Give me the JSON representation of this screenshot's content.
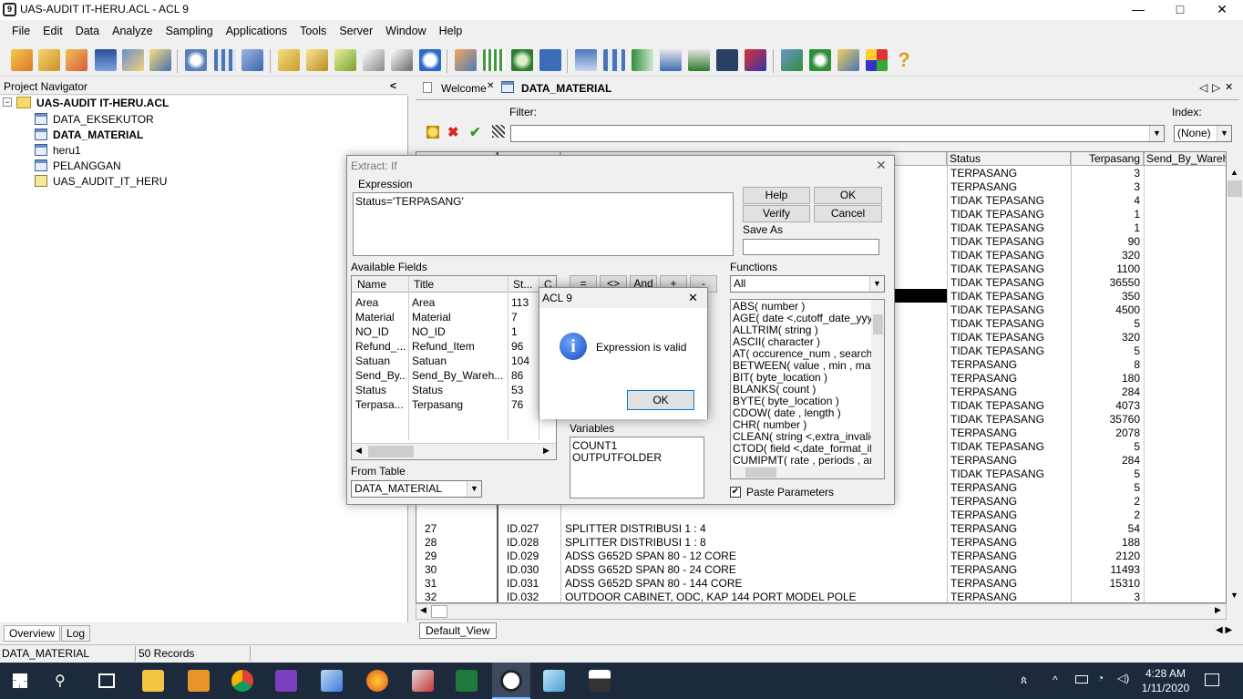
{
  "window": {
    "title": "UAS-AUDIT IT-HERU.ACL - ACL 9",
    "min": "—",
    "max": "□",
    "close": "✕",
    "icon_text": "9"
  },
  "menu": [
    "File",
    "Edit",
    "Data",
    "Analyze",
    "Sampling",
    "Applications",
    "Tools",
    "Server",
    "Window",
    "Help"
  ],
  "navigator": {
    "title": "Project Navigator",
    "collapse": "<",
    "project": "UAS-AUDIT IT-HERU.ACL",
    "expander": "−",
    "items": [
      {
        "label": "DATA_EKSEKUTOR",
        "bold": false
      },
      {
        "label": "DATA_MATERIAL",
        "bold": true
      },
      {
        "label": "heru1",
        "bold": false
      },
      {
        "label": "PELANGGAN",
        "bold": false
      },
      {
        "label": "UAS_AUDIT_IT_HERU",
        "bold": false
      }
    ],
    "tabs": [
      "Overview",
      "Log"
    ]
  },
  "tabs": {
    "welcome": "Welcome",
    "active": "DATA_MATERIAL",
    "nav_prev": "◁",
    "nav_next": "▷",
    "close": "✕"
  },
  "filter": {
    "label": "Filter:",
    "value": "",
    "index_label": "Index:",
    "index_value": "(None)"
  },
  "grid": {
    "headers": {
      "status": "Status",
      "terpasang": "Terpasang",
      "send": "Send_By_Wareh"
    },
    "upper_rows": [
      {
        "status": "TERPASANG",
        "terpasang": "3"
      },
      {
        "status": "TERPASANG",
        "terpasang": "3"
      },
      {
        "status": "TIDAK TEPASANG",
        "terpasang": "4"
      },
      {
        "status": "TIDAK TEPASANG",
        "terpasang": "1"
      },
      {
        "status": "TIDAK TEPASANG",
        "terpasang": "1"
      },
      {
        "status": "TIDAK TEPASANG",
        "terpasang": "90"
      },
      {
        "status": "TIDAK TEPASANG",
        "terpasang": "320"
      },
      {
        "status": "TIDAK TEPASANG",
        "terpasang": "1100"
      },
      {
        "status": "TIDAK TEPASANG",
        "terpasang": "36550"
      },
      {
        "status": "TIDAK TEPASANG",
        "terpasang": "350"
      },
      {
        "status": "TIDAK TEPASANG",
        "terpasang": "4500"
      },
      {
        "status": "TIDAK TEPASANG",
        "terpasang": "5"
      },
      {
        "status": "TIDAK TEPASANG",
        "terpasang": "320"
      },
      {
        "status": "TIDAK TEPASANG",
        "terpasang": "5"
      },
      {
        "status": "TERPASANG",
        "terpasang": "8"
      },
      {
        "status": "TERPASANG",
        "terpasang": "180"
      },
      {
        "status": "TERPASANG",
        "terpasang": "284"
      },
      {
        "status": "TIDAK TEPASANG",
        "terpasang": "4073"
      },
      {
        "status": "TIDAK TEPASANG",
        "terpasang": "35760"
      },
      {
        "status": "TERPASANG",
        "terpasang": "2078"
      },
      {
        "status": "TIDAK TEPASANG",
        "terpasang": "5"
      },
      {
        "status": "TERPASANG",
        "terpasang": "284"
      },
      {
        "status": "TIDAK TEPASANG",
        "terpasang": "5"
      },
      {
        "status": "TERPASANG",
        "terpasang": "5"
      },
      {
        "status": "TERPASANG",
        "terpasang": "2"
      },
      {
        "status": "TERPASANG",
        "terpasang": "2"
      }
    ],
    "lower_rows": [
      {
        "num": "27",
        "id": "ID.027",
        "name": "SPLITTER  DISTRIBUSI 1 : 4",
        "status": "TERPASANG",
        "terpasang": "54"
      },
      {
        "num": "28",
        "id": "ID.028",
        "name": "SPLITTER  DISTRIBUSI 1 : 8",
        "status": "TERPASANG",
        "terpasang": "188"
      },
      {
        "num": "29",
        "id": "ID.029",
        "name": "ADSS  G652D SPAN 80  - 12 CORE",
        "status": "TERPASANG",
        "terpasang": "2120"
      },
      {
        "num": "30",
        "id": "ID.030",
        "name": "ADSS  G652D SPAN 80  - 24 CORE",
        "status": "TERPASANG",
        "terpasang": "11493"
      },
      {
        "num": "31",
        "id": "ID.031",
        "name": "ADSS  G652D SPAN 80  - 144 CORE",
        "status": "TERPASANG",
        "terpasang": "15310"
      },
      {
        "num": "32",
        "id": "ID.032",
        "name": "OUTDOOR CABINET, ODC, KAP 144 PORT  MODEL POLE",
        "status": "TERPASANG",
        "terpasang": "3"
      }
    ],
    "view_tab": "Default_View"
  },
  "status": {
    "table": "DATA_MATERIAL",
    "records": "50 Records"
  },
  "extract": {
    "title": "Extract: If",
    "expression_label": "Expression",
    "expression": "Status='TERPASANG'",
    "buttons": {
      "help": "Help",
      "ok": "OK",
      "verify": "Verify",
      "cancel": "Cancel"
    },
    "save_as_label": "Save As",
    "available_fields_label": "Available Fields",
    "field_headers": {
      "name": "Name",
      "title": "Title",
      "start": "St...",
      "c": "C"
    },
    "fields": [
      {
        "name": "Area",
        "title": "Area",
        "start": "113"
      },
      {
        "name": "Material",
        "title": "Material",
        "start": "7"
      },
      {
        "name": "NO_ID",
        "title": "NO_ID",
        "start": "1"
      },
      {
        "name": "Refund_...",
        "title": "Refund_Item",
        "start": "96"
      },
      {
        "name": "Satuan",
        "title": "Satuan",
        "start": "104"
      },
      {
        "name": "Send_By...",
        "title": "Send_By_Wareh...",
        "start": "86"
      },
      {
        "name": "Status",
        "title": "Status",
        "start": "53"
      },
      {
        "name": "Terpasa...",
        "title": "Terpasang",
        "start": "76"
      }
    ],
    "operators": [
      "=",
      "<>",
      "And",
      "+",
      "-"
    ],
    "functions_label": "Functions",
    "functions_filter": "All",
    "functions": [
      "ABS( number )",
      "AGE( date <,cutoff_date_yyyymm",
      "ALLTRIM( string )",
      "ASCII( character )",
      "AT( occurence_num , search_fo",
      "BETWEEN( value , min , max )",
      "BIT( byte_location )",
      "BLANKS( count )",
      "BYTE( byte_location )",
      "CDOW( date , length )",
      "CHR( number )",
      "CLEAN( string <,extra_invalid_cl",
      "CTOD( field <,date_format_if_nc",
      "CUMIPMT( rate , periods , amou"
    ],
    "variables_label": "Variables",
    "variables": [
      "COUNT1",
      "OUTPUTFOLDER"
    ],
    "from_table_label": "From Table",
    "from_table": "DATA_MATERIAL",
    "paste_params": "Paste Parameters",
    "check_mark": "✔"
  },
  "msgbox": {
    "title": "ACL 9",
    "message": "Expression is valid",
    "ok": "OK",
    "icon": "i",
    "close": "✕"
  },
  "taskbar": {
    "time": "4:28 AM",
    "date": "1/11/2020"
  }
}
